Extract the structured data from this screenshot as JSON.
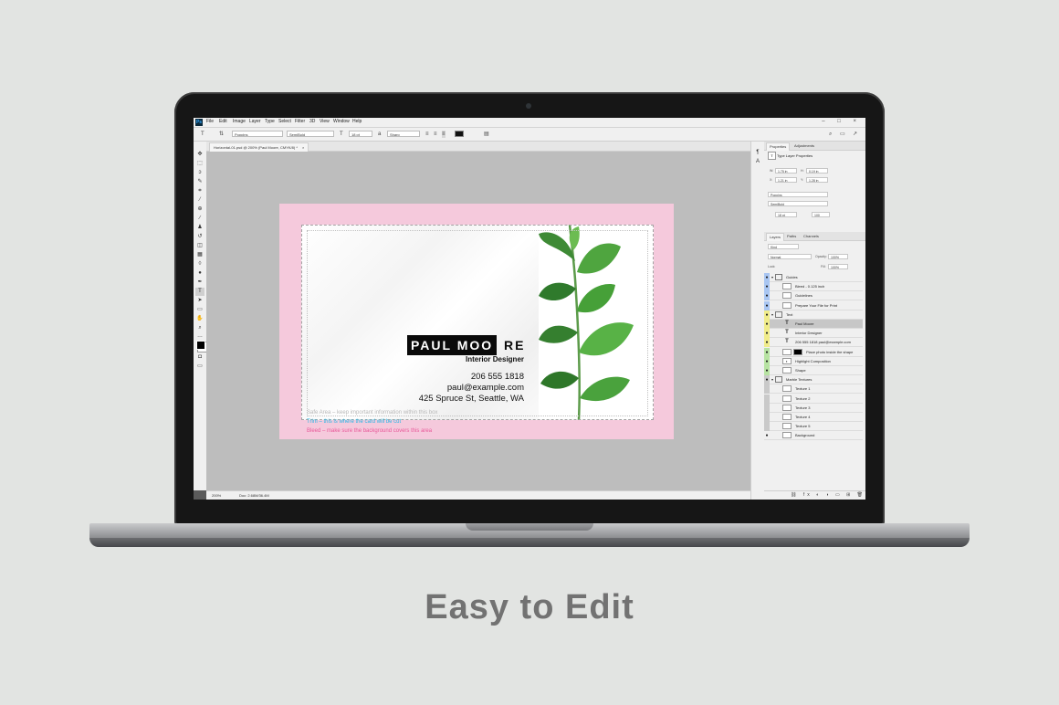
{
  "caption": "Easy to Edit",
  "menu": {
    "app_logo": "Ps",
    "items": [
      "File",
      "Edit",
      "Image",
      "Layer",
      "Type",
      "Select",
      "Filter",
      "3D",
      "View",
      "Window",
      "Help"
    ],
    "window_controls": "– □ ×"
  },
  "options_bar": {
    "font_family": "Poppins",
    "font_style": "SemiBold",
    "font_size": "18 pt",
    "anti_alias": "Sharp",
    "text_color": "#000000"
  },
  "document": {
    "tab_label": "Horizontal-01.psd @ 200% (Paul Moore, CMYK/8) *",
    "tab_close": "×"
  },
  "status_bar": {
    "zoom": "200%",
    "doc_size": "Doc: 2.68M/36.4M"
  },
  "properties": {
    "tabs": [
      "Properties",
      "Adjustments"
    ],
    "title": "Type Layer Properties",
    "w_label": "W:",
    "w_value": "1.75 in",
    "h_label": "H:",
    "h_value": "0.19 in",
    "x_label": "X:",
    "x_value": "1.21 in",
    "y_label": "Y:",
    "y_value": "1.28 in",
    "font": "Poppins",
    "style": "SemiBold",
    "size": "18 pt",
    "tracking": "100"
  },
  "layers_panel": {
    "tabs": [
      "Layers",
      "Paths",
      "Channels"
    ],
    "filter": "Kind",
    "blend": "Normal",
    "opacity_label": "Opacity:",
    "opacity": "100%",
    "lock_label": "Lock:",
    "fill_label": "Fill:",
    "fill": "100%",
    "items": [
      {
        "name": "Guides",
        "kind": "folder"
      },
      {
        "name": "Bleed - 0.125 inch",
        "kind": "layer"
      },
      {
        "name": "Guidelines",
        "kind": "layer"
      },
      {
        "name": "Prepare Your File for Print",
        "kind": "layer"
      },
      {
        "name": "Text",
        "kind": "folder"
      },
      {
        "name": "Paul Moore",
        "kind": "type",
        "selected": true
      },
      {
        "name": "Interior Designer",
        "kind": "type"
      },
      {
        "name": "206 555 1818 paul@example.com",
        "kind": "type"
      },
      {
        "name": "Place photo inside the shape",
        "kind": "smart"
      },
      {
        "name": "Highlight Composition",
        "kind": "adjust"
      },
      {
        "name": "Shape",
        "kind": "layer"
      },
      {
        "name": "Marble Textures",
        "kind": "folder"
      },
      {
        "name": "Texture 1",
        "kind": "layer"
      },
      {
        "name": "Texture 2",
        "kind": "layer"
      },
      {
        "name": "Texture 3",
        "kind": "layer"
      },
      {
        "name": "Texture 4",
        "kind": "layer"
      },
      {
        "name": "Texture 5",
        "kind": "layer"
      },
      {
        "name": "Background",
        "kind": "layer"
      }
    ]
  },
  "card": {
    "name_black": "PAUL MOO",
    "name_rest": "RE",
    "title": "Interior Designer",
    "phone": "206 555 1818",
    "email": "paul@example.com",
    "address": "425 Spruce St, Seattle, WA",
    "hint_safe": "Safe Area – keep important information within this box",
    "hint_trim": "Trim – this is where the card will be cut",
    "hint_bleed": "Bleed – make sure the background covers this area"
  },
  "colors": {
    "bleed_pink": "#f5c9dc",
    "hint_safe": "#b8b8b8",
    "hint_trim": "#25b7e6",
    "hint_bleed": "#e85a9a",
    "leaf_green": "#3f9a3a",
    "tag_blue": "#a9c6f2",
    "tag_yellow": "#f0ec8a",
    "tag_green": "#b7e3a2",
    "tag_gray": "#c9c9c9"
  }
}
